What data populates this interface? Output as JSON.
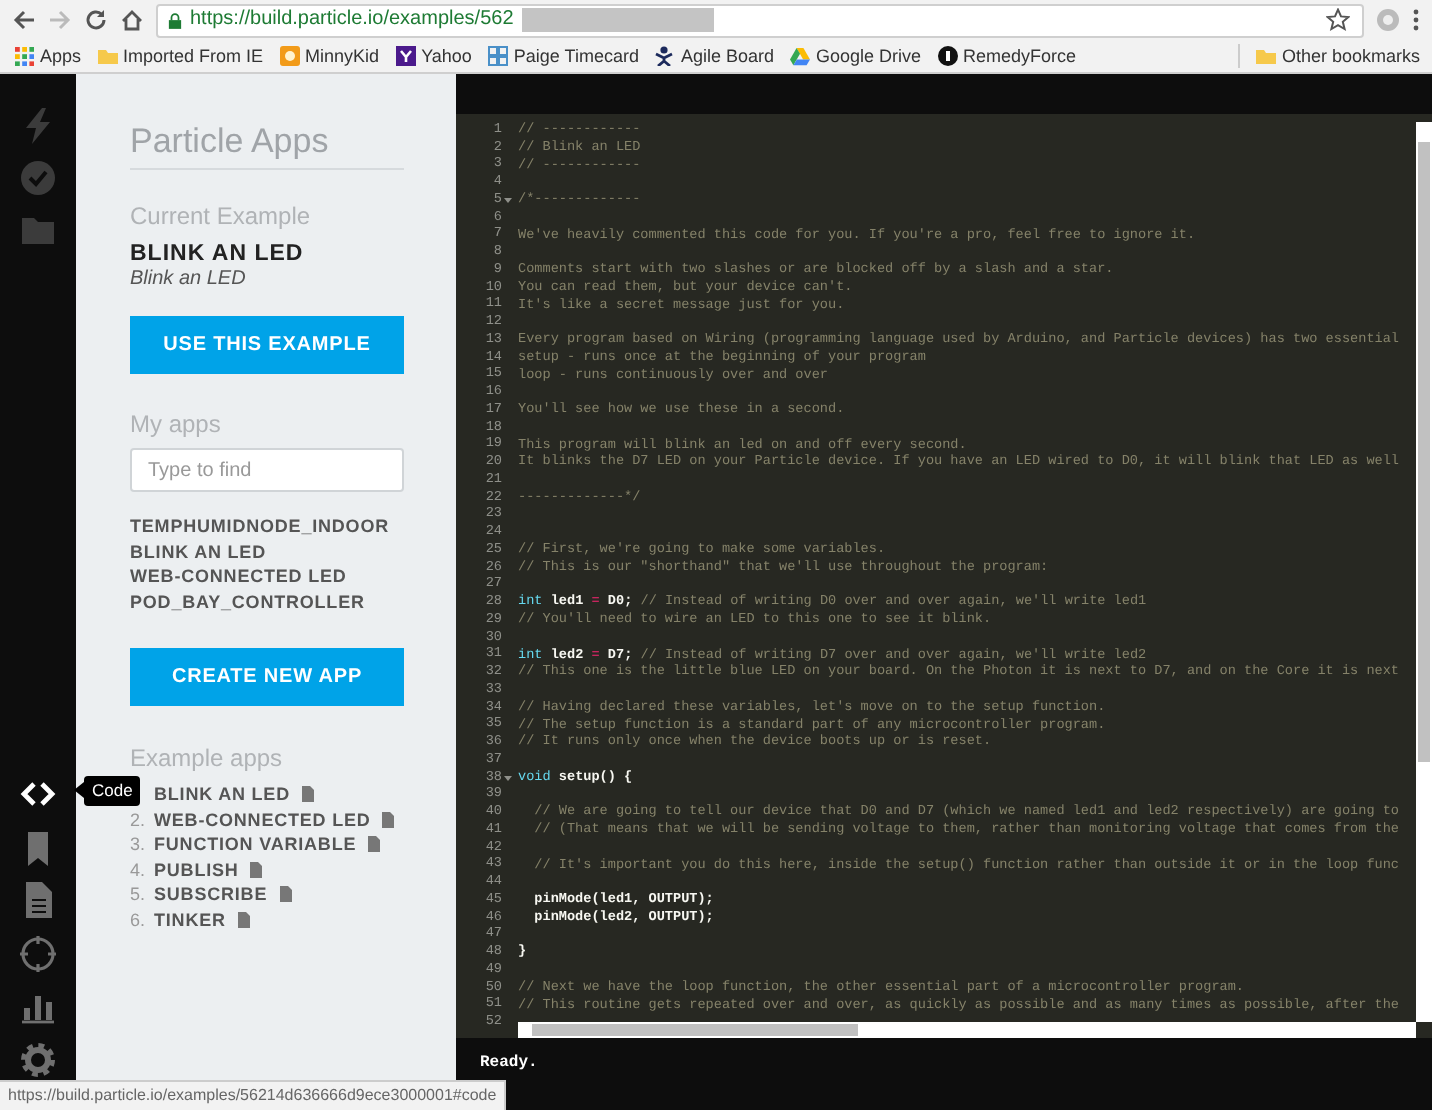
{
  "browser": {
    "url": "https://build.particle.io/examples/562",
    "bookmarks": [
      {
        "kind": "apps",
        "label": "Apps"
      },
      {
        "kind": "folder",
        "label": "Imported From IE"
      },
      {
        "kind": "minnykid",
        "label": "MinnyKid"
      },
      {
        "kind": "yahoo",
        "label": "Yahoo"
      },
      {
        "kind": "grid",
        "label": "Paige Timecard"
      },
      {
        "kind": "agile",
        "label": "Agile Board"
      },
      {
        "kind": "drive",
        "label": "Google Drive"
      },
      {
        "kind": "remedy",
        "label": "RemedyForce"
      }
    ],
    "other_bookmarks": "Other bookmarks"
  },
  "rail": {
    "top": [
      {
        "kind": "bolt",
        "selected": false
      },
      {
        "kind": "check",
        "selected": false
      },
      {
        "kind": "folder",
        "selected": false
      }
    ],
    "bottom": [
      {
        "kind": "code",
        "selected": true
      },
      {
        "kind": "bookmark",
        "selected": false
      },
      {
        "kind": "document",
        "selected": false
      },
      {
        "kind": "crosshair",
        "selected": false
      },
      {
        "kind": "chart",
        "selected": false
      },
      {
        "kind": "gear",
        "selected": false
      }
    ],
    "tooltip": "Code"
  },
  "sidebar": {
    "title": "Particle Apps",
    "current_heading": "Current Example",
    "current_name": "BLINK AN LED",
    "current_subtitle": "Blink an LED",
    "use_button": "USE THIS EXAMPLE",
    "my_apps_heading": "My apps",
    "search": {
      "placeholder": "Type to find"
    },
    "my_apps": [
      "TEMPHUMIDNODE_INDOOR",
      "BLINK AN LED",
      "WEB-CONNECTED LED",
      "POD_BAY_CONTROLLER"
    ],
    "create_button": "CREATE NEW APP",
    "examples_heading": "Example apps",
    "examples": [
      {
        "name": "BLINK AN LED"
      },
      {
        "number": "2.",
        "name": "WEB-CONNECTED LED"
      },
      {
        "number": "3.",
        "name": "FUNCTION VARIABLE"
      },
      {
        "number": "4.",
        "name": "PUBLISH"
      },
      {
        "number": "5.",
        "name": "SUBSCRIBE"
      },
      {
        "number": "6.",
        "name": "TINKER"
      }
    ]
  },
  "editor": {
    "lines": [
      {
        "number": "1",
        "fold": false,
        "tokens": [
          {
            "kind": "comment",
            "text": "// ------------"
          }
        ]
      },
      {
        "number": "2",
        "fold": false,
        "tokens": [
          {
            "kind": "comment",
            "text": "// Blink an LED"
          }
        ]
      },
      {
        "number": "3",
        "fold": false,
        "tokens": [
          {
            "kind": "comment",
            "text": "// ------------"
          }
        ]
      },
      {
        "number": "4",
        "fold": false
      },
      {
        "number": "5",
        "fold": true,
        "tokens": [
          {
            "kind": "comment",
            "text": "/*-------------"
          }
        ]
      },
      {
        "number": "6",
        "fold": false
      },
      {
        "number": "7",
        "fold": false,
        "tokens": [
          {
            "kind": "comment",
            "text": "We've heavily commented this code for you. If you're a pro, feel free to ignore it."
          }
        ]
      },
      {
        "number": "8",
        "fold": false
      },
      {
        "number": "9",
        "fold": false,
        "tokens": [
          {
            "kind": "comment",
            "text": "Comments start with two slashes or are blocked off by a slash and a star."
          }
        ]
      },
      {
        "number": "10",
        "fold": false,
        "tokens": [
          {
            "kind": "comment",
            "text": "You can read them, but your device can't."
          }
        ]
      },
      {
        "number": "11",
        "fold": false,
        "tokens": [
          {
            "kind": "comment",
            "text": "It's like a secret message just for you."
          }
        ]
      },
      {
        "number": "12",
        "fold": false
      },
      {
        "number": "13",
        "fold": false,
        "tokens": [
          {
            "kind": "comment",
            "text": "Every program based on Wiring (programming language used by Arduino, and Particle devices) has two essential"
          }
        ]
      },
      {
        "number": "14",
        "fold": false,
        "tokens": [
          {
            "kind": "comment",
            "text": "setup - runs once at the beginning of your program"
          }
        ]
      },
      {
        "number": "15",
        "fold": false,
        "tokens": [
          {
            "kind": "comment",
            "text": "loop - runs continuously over and over"
          }
        ]
      },
      {
        "number": "16",
        "fold": false
      },
      {
        "number": "17",
        "fold": false,
        "tokens": [
          {
            "kind": "comment",
            "text": "You'll see how we use these in a second."
          }
        ]
      },
      {
        "number": "18",
        "fold": false
      },
      {
        "number": "19",
        "fold": false,
        "tokens": [
          {
            "kind": "comment",
            "text": "This program will blink an led on and off every second."
          }
        ]
      },
      {
        "number": "20",
        "fold": false,
        "tokens": [
          {
            "kind": "comment",
            "text": "It blinks the D7 LED on your Particle device. If you have an LED wired to D0, it will blink that LED as well"
          }
        ]
      },
      {
        "number": "21",
        "fold": false
      },
      {
        "number": "22",
        "fold": false,
        "tokens": [
          {
            "kind": "comment",
            "text": "-------------*/"
          }
        ]
      },
      {
        "number": "23",
        "fold": false
      },
      {
        "number": "24",
        "fold": false
      },
      {
        "number": "25",
        "fold": false,
        "tokens": [
          {
            "kind": "comment",
            "text": "// First, we're going to make some variables."
          }
        ]
      },
      {
        "number": "26",
        "fold": false,
        "tokens": [
          {
            "kind": "comment",
            "text": "// This is our \"shorthand\" that we'll use throughout the program:"
          }
        ]
      },
      {
        "number": "27",
        "fold": false
      },
      {
        "number": "28",
        "fold": false,
        "tokens": [
          {
            "kind": "keyword",
            "text": "int"
          },
          {
            "kind": "plain",
            "text": " led1 "
          },
          {
            "kind": "operator",
            "text": "="
          },
          {
            "kind": "plain",
            "text": " D0;"
          },
          {
            "kind": "comment",
            "text": " // Instead of writing D0 over and over again, we'll write led1"
          }
        ]
      },
      {
        "number": "29",
        "fold": false,
        "tokens": [
          {
            "kind": "comment",
            "text": "// You'll need to wire an LED to this one to see it blink."
          }
        ]
      },
      {
        "number": "30",
        "fold": false
      },
      {
        "number": "31",
        "fold": false,
        "tokens": [
          {
            "kind": "keyword",
            "text": "int"
          },
          {
            "kind": "plain",
            "text": " led2 "
          },
          {
            "kind": "operator",
            "text": "="
          },
          {
            "kind": "plain",
            "text": " D7;"
          },
          {
            "kind": "comment",
            "text": " // Instead of writing D7 over and over again, we'll write led2"
          }
        ]
      },
      {
        "number": "32",
        "fold": false,
        "tokens": [
          {
            "kind": "comment",
            "text": "// This one is the little blue LED on your board. On the Photon it is next to D7, and on the Core it is next"
          }
        ]
      },
      {
        "number": "33",
        "fold": false
      },
      {
        "number": "34",
        "fold": false,
        "tokens": [
          {
            "kind": "comment",
            "text": "// Having declared these variables, let's move on to the setup function."
          }
        ]
      },
      {
        "number": "35",
        "fold": false,
        "tokens": [
          {
            "kind": "comment",
            "text": "// The setup function is a standard part of any microcontroller program."
          }
        ]
      },
      {
        "number": "36",
        "fold": false,
        "tokens": [
          {
            "kind": "comment",
            "text": "// It runs only once when the device boots up or is reset."
          }
        ]
      },
      {
        "number": "37",
        "fold": false
      },
      {
        "number": "38",
        "fold": true,
        "tokens": [
          {
            "kind": "keyword",
            "text": "void"
          },
          {
            "kind": "plain",
            "text": " setup() {"
          }
        ]
      },
      {
        "number": "39",
        "fold": false
      },
      {
        "number": "40",
        "fold": false,
        "tokens": [
          {
            "kind": "comment",
            "text": "  // We are going to tell our device that D0 and D7 (which we named led1 and led2 respectively) are going to"
          }
        ]
      },
      {
        "number": "41",
        "fold": false,
        "tokens": [
          {
            "kind": "comment",
            "text": "  // (That means that we will be sending voltage to them, rather than monitoring voltage that comes from the"
          }
        ]
      },
      {
        "number": "42",
        "fold": false
      },
      {
        "number": "43",
        "fold": false,
        "tokens": [
          {
            "kind": "comment",
            "text": "  // It's important you do this here, inside the setup() function rather than outside it or in the loop func"
          }
        ]
      },
      {
        "number": "44",
        "fold": false
      },
      {
        "number": "45",
        "fold": false,
        "tokens": [
          {
            "kind": "plain",
            "text": "  pinMode(led1, OUTPUT);"
          }
        ]
      },
      {
        "number": "46",
        "fold": false,
        "tokens": [
          {
            "kind": "plain",
            "text": "  pinMode(led2, OUTPUT);"
          }
        ]
      },
      {
        "number": "47",
        "fold": false
      },
      {
        "number": "48",
        "fold": false,
        "tokens": [
          {
            "kind": "plain",
            "text": "}"
          }
        ]
      },
      {
        "number": "49",
        "fold": false
      },
      {
        "number": "50",
        "fold": false,
        "tokens": [
          {
            "kind": "comment",
            "text": "// Next we have the loop function, the other essential part of a microcontroller program."
          }
        ]
      },
      {
        "number": "51",
        "fold": false,
        "tokens": [
          {
            "kind": "comment",
            "text": "// This routine gets repeated over and over, as quickly as possible and as many times as possible, after the"
          }
        ]
      },
      {
        "number": "52",
        "fold": false
      }
    ],
    "status": "Ready."
  },
  "status_url": "https://build.particle.io/examples/56214d636666d9ece3000001#code"
}
